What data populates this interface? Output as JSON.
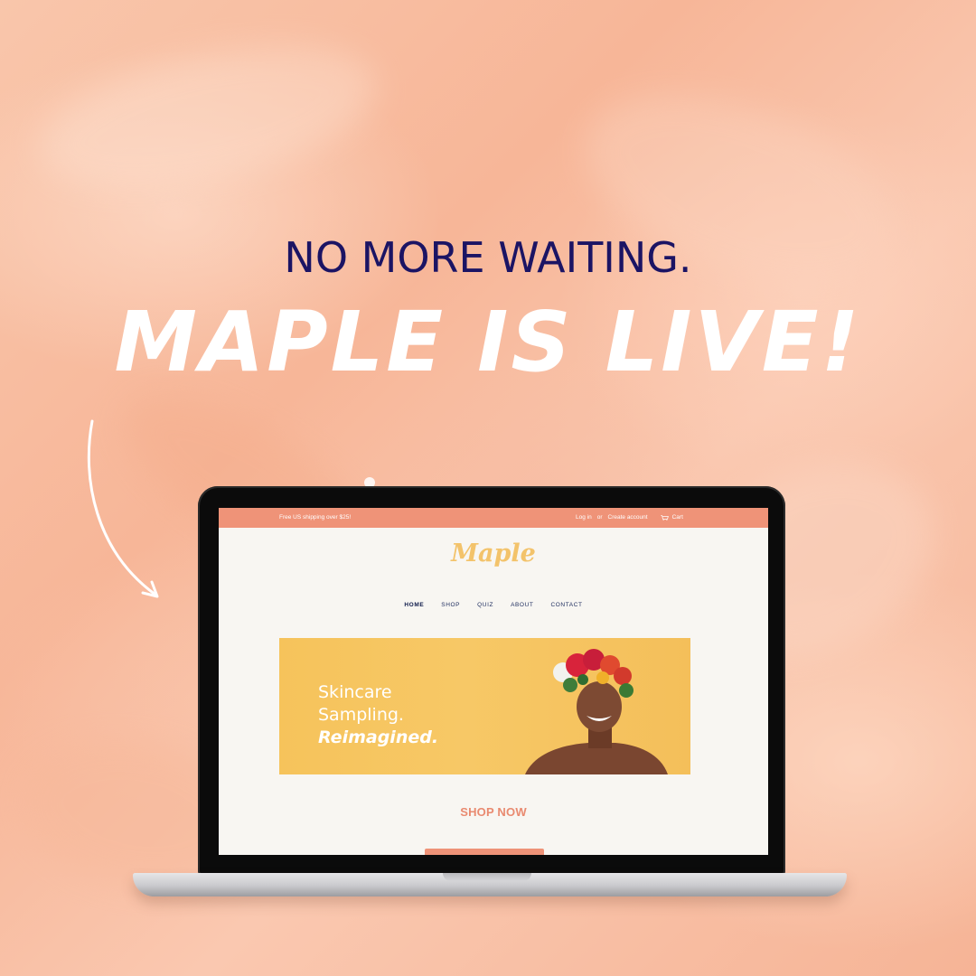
{
  "headline": {
    "line1": "NO MORE WAITING.",
    "line2": "MAPLE IS LIVE!"
  },
  "website": {
    "announcement": {
      "shipping": "Free US shipping over $25!",
      "login": "Log in",
      "or": "or",
      "create_account": "Create account",
      "cart": "Cart"
    },
    "logo": "Maple",
    "nav": [
      "HOME",
      "SHOP",
      "QUIZ",
      "ABOUT",
      "CONTACT"
    ],
    "hero": {
      "line1": "Skincare",
      "line2": "Sampling.",
      "line3": "Reimagined."
    },
    "cta": "SHOP NOW"
  },
  "colors": {
    "headline_dark": "#1b1464",
    "accent_coral": "#ef9378",
    "logo_yellow": "#f3c36b",
    "hero_yellow": "#f6c35b"
  }
}
